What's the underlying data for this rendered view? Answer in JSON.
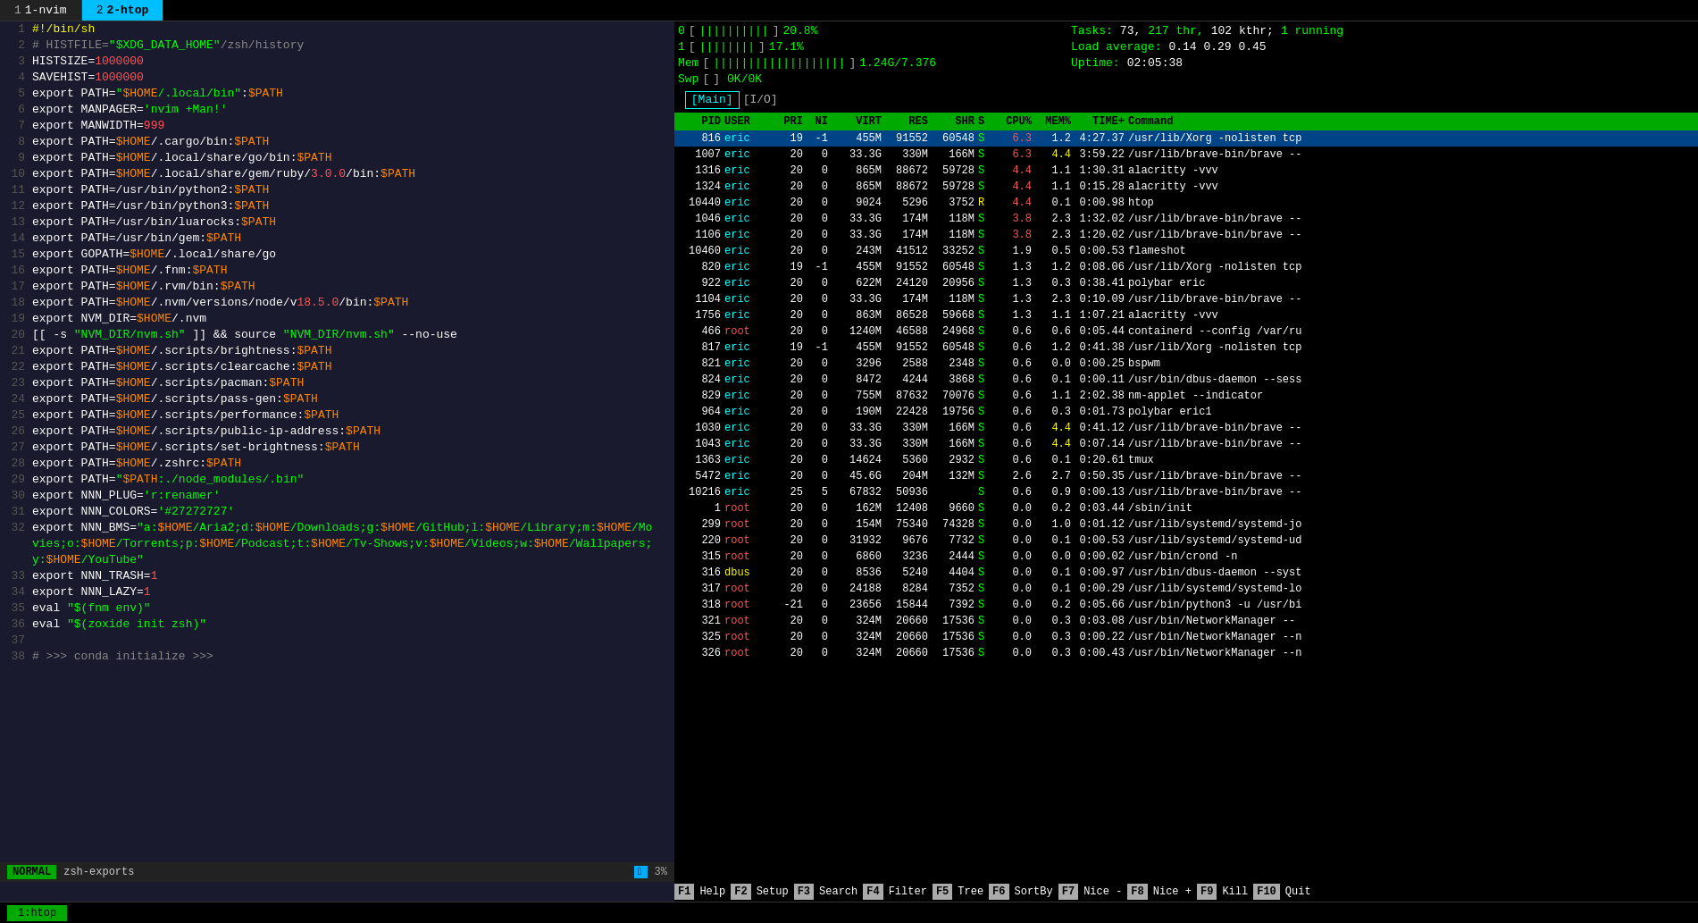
{
  "tabs": [
    {
      "id": "nvim",
      "num": "1",
      "name": "1-nvim",
      "active": false
    },
    {
      "id": "htop",
      "num": "2",
      "name": "2-htop",
      "active": true
    }
  ],
  "nvim": {
    "lines": [
      {
        "num": "1",
        "content": "#!/bin/sh"
      },
      {
        "num": "2",
        "content": "# HISTFILE=\"$XDG_DATA_HOME\"/zsh/history"
      },
      {
        "num": "3",
        "content": "HISTSIZE=1000000"
      },
      {
        "num": "4",
        "content": "SAVEHIST=1000000"
      },
      {
        "num": "5",
        "content": "export PATH=\"$HOME/.local/bin\":$PATH"
      },
      {
        "num": "6",
        "content": "export MANPAGER='nvim +Man!'"
      },
      {
        "num": "7",
        "content": "export MANWIDTH=999"
      },
      {
        "num": "8",
        "content": "export PATH=$HOME/.cargo/bin:$PATH"
      },
      {
        "num": "9",
        "content": "export PATH=$HOME/.local/share/go/bin:$PATH"
      },
      {
        "num": "10",
        "content": "export PATH=$HOME/.local/share/gem/ruby/3.0.0/bin:$PATH"
      },
      {
        "num": "11",
        "content": "export PATH=/usr/bin/python2:$PATH"
      },
      {
        "num": "12",
        "content": "export PATH=/usr/bin/python3:$PATH"
      },
      {
        "num": "13",
        "content": "export PATH=/usr/bin/luarocks:$PATH"
      },
      {
        "num": "14",
        "content": "export PATH=/usr/bin/gem:$PATH"
      },
      {
        "num": "15",
        "content": "export GOPATH=$HOME/.local/share/go"
      },
      {
        "num": "16",
        "content": "export PATH=$HOME/.fnm:$PATH"
      },
      {
        "num": "17",
        "content": "export PATH=$HOME/.rvm/bin:$PATH"
      },
      {
        "num": "18",
        "content": "export PATH=$HOME/.nvm/versions/node/v18.5.0/bin:$PATH"
      },
      {
        "num": "19",
        "content": "export NVM_DIR=$HOME/.nvm"
      },
      {
        "num": "20",
        "content": "[[ -s \"NVM_DIR/nvm.sh\" ]] && source \"NVM_DIR/nvm.sh\" --no-use"
      },
      {
        "num": "21",
        "content": "export PATH=$HOME/.scripts/brightness:$PATH"
      },
      {
        "num": "22",
        "content": "export PATH=$HOME/.scripts/clearcache:$PATH"
      },
      {
        "num": "23",
        "content": "export PATH=$HOME/.scripts/pacman:$PATH"
      },
      {
        "num": "24",
        "content": "export PATH=$HOME/.scripts/pass-gen:$PATH"
      },
      {
        "num": "25",
        "content": "export PATH=$HOME/.scripts/performance:$PATH"
      },
      {
        "num": "26",
        "content": "export PATH=$HOME/.scripts/public-ip-address:$PATH"
      },
      {
        "num": "27",
        "content": "export PATH=$HOME/.scripts/set-brightness:$PATH"
      },
      {
        "num": "28",
        "content": "export PATH=$HOME/.zshrc:$PATH"
      },
      {
        "num": "29",
        "content": "export PATH=\"$PATH:./node_modules/.bin\""
      },
      {
        "num": "30",
        "content": "export NNN_PLUG='r:renamer'"
      },
      {
        "num": "31",
        "content": "export NNN_COLORS='#27272727'"
      },
      {
        "num": "32",
        "content": "export NNN_BMS=\"a:$HOME/Aria2;d:$HOME/Downloads;g:$HOME/GitHub;l:$HOME/Library;m:$HOME/Mo"
      },
      {
        "num": "",
        "content": "vies;o:$HOME/Torrents;p:$HOME/Podcast;t:$HOME/Tv-Shows;v:$HOME/Videos;w:$HOME/Wallpapers;"
      },
      {
        "num": "",
        "content": "y:$HOME/YouTube\""
      },
      {
        "num": "33",
        "content": "export NNN_TRASH=1"
      },
      {
        "num": "34",
        "content": "export NNN_LAZY=1"
      },
      {
        "num": "35",
        "content": "eval \"$(fnm env)\""
      },
      {
        "num": "36",
        "content": "eval \"$(zoxide init zsh)\""
      },
      {
        "num": "37",
        "content": ""
      },
      {
        "num": "38",
        "content": "# >>> conda initialize >>>"
      }
    ],
    "mode": "NORMAL",
    "filename": "zsh-exports",
    "file_icon": "",
    "pct": "3%"
  },
  "htop": {
    "cpu0_label": "0",
    "cpu0_bar": "||||||||||",
    "cpu0_pct": "20.8%",
    "cpu1_label": "1",
    "cpu1_bar": "||||||||",
    "cpu1_pct": "17.1%",
    "mem_label": "Mem",
    "mem_bar": "|||||||||||||||||||",
    "mem_val": "1.24G/7.376",
    "swp_label": "Swp",
    "swp_bar": "",
    "swp_val": "0K/0K",
    "tasks_label": "Tasks:",
    "tasks_val": "73, 217 thr, 102 kthr; 1 running",
    "load_label": "Load average:",
    "load_val": "0.14 0.29 0.45",
    "uptime_label": "Uptime:",
    "uptime_val": "02:05:38",
    "menu": "[Main] [I/O]",
    "columns": [
      "PID",
      "USER",
      "PRI",
      "NI",
      "VIRT",
      "RES",
      "SHR",
      "S",
      "CPU%",
      "MEM%",
      "TIME+",
      "Command"
    ],
    "processes": [
      {
        "pid": "816",
        "user": "eric",
        "pri": "19",
        "ni": "-1",
        "virt": "455M",
        "res": "91552",
        "shr": "60548",
        "s": "S",
        "cpu": "6.3",
        "mem": "1.2",
        "time": "4:27.37",
        "cmd": "/usr/lib/Xorg -nolisten tcp",
        "highlight": true
      },
      {
        "pid": "1007",
        "user": "eric",
        "pri": "20",
        "ni": "0",
        "virt": "33.3G",
        "res": "330M",
        "shr": "166M",
        "s": "S",
        "cpu": "6.3",
        "mem": "4.4",
        "time": "3:59.22",
        "cmd": "/usr/lib/brave-bin/brave --"
      },
      {
        "pid": "1316",
        "user": "eric",
        "pri": "20",
        "ni": "0",
        "virt": "865M",
        "res": "88672",
        "shr": "59728",
        "s": "S",
        "cpu": "4.4",
        "mem": "1.1",
        "time": "1:30.31",
        "cmd": "alacritty -vvv"
      },
      {
        "pid": "1324",
        "user": "eric",
        "pri": "20",
        "ni": "0",
        "virt": "865M",
        "res": "88672",
        "shr": "59728",
        "s": "S",
        "cpu": "4.4",
        "mem": "1.1",
        "time": "0:15.28",
        "cmd": "alacritty -vvv"
      },
      {
        "pid": "10440",
        "user": "eric",
        "pri": "20",
        "ni": "0",
        "virt": "9024",
        "res": "5296",
        "shr": "3752",
        "s": "R",
        "cpu": "4.4",
        "mem": "0.1",
        "time": "0:00.98",
        "cmd": "htop"
      },
      {
        "pid": "1046",
        "user": "eric",
        "pri": "20",
        "ni": "0",
        "virt": "33.3G",
        "res": "174M",
        "shr": "118M",
        "s": "S",
        "cpu": "3.8",
        "mem": "2.3",
        "time": "1:32.02",
        "cmd": "/usr/lib/brave-bin/brave --"
      },
      {
        "pid": "1106",
        "user": "eric",
        "pri": "20",
        "ni": "0",
        "virt": "33.3G",
        "res": "174M",
        "shr": "118M",
        "s": "S",
        "cpu": "3.8",
        "mem": "2.3",
        "time": "1:20.02",
        "cmd": "/usr/lib/brave-bin/brave --"
      },
      {
        "pid": "10460",
        "user": "eric",
        "pri": "20",
        "ni": "0",
        "virt": "243M",
        "res": "41512",
        "shr": "33252",
        "s": "S",
        "cpu": "1.9",
        "mem": "0.5",
        "time": "0:00.53",
        "cmd": "flameshot"
      },
      {
        "pid": "820",
        "user": "eric",
        "pri": "19",
        "ni": "-1",
        "virt": "455M",
        "res": "91552",
        "shr": "60548",
        "s": "S",
        "cpu": "1.3",
        "mem": "1.2",
        "time": "0:08.06",
        "cmd": "/usr/lib/Xorg -nolisten tcp"
      },
      {
        "pid": "922",
        "user": "eric",
        "pri": "20",
        "ni": "0",
        "virt": "622M",
        "res": "24120",
        "shr": "20956",
        "s": "S",
        "cpu": "1.3",
        "mem": "0.3",
        "time": "0:38.41",
        "cmd": "polybar eric"
      },
      {
        "pid": "1104",
        "user": "eric",
        "pri": "20",
        "ni": "0",
        "virt": "33.3G",
        "res": "174M",
        "shr": "118M",
        "s": "S",
        "cpu": "1.3",
        "mem": "2.3",
        "time": "0:10.09",
        "cmd": "/usr/lib/brave-bin/brave --"
      },
      {
        "pid": "1756",
        "user": "eric",
        "pri": "20",
        "ni": "0",
        "virt": "863M",
        "res": "86528",
        "shr": "59668",
        "s": "S",
        "cpu": "1.3",
        "mem": "1.1",
        "time": "1:07.21",
        "cmd": "alacritty -vvv"
      },
      {
        "pid": "466",
        "user": "root",
        "pri": "20",
        "ni": "0",
        "virt": "1240M",
        "res": "46588",
        "shr": "24968",
        "s": "S",
        "cpu": "0.6",
        "mem": "0.6",
        "time": "0:05.44",
        "cmd": "containerd --config /var/ru"
      },
      {
        "pid": "817",
        "user": "eric",
        "pri": "19",
        "ni": "-1",
        "virt": "455M",
        "res": "91552",
        "shr": "60548",
        "s": "S",
        "cpu": "0.6",
        "mem": "1.2",
        "time": "0:41.38",
        "cmd": "/usr/lib/Xorg -nolisten tcp"
      },
      {
        "pid": "821",
        "user": "eric",
        "pri": "20",
        "ni": "0",
        "virt": "3296",
        "res": "2588",
        "shr": "2348",
        "s": "S",
        "cpu": "0.6",
        "mem": "0.0",
        "time": "0:00.25",
        "cmd": "bspwm"
      },
      {
        "pid": "824",
        "user": "eric",
        "pri": "20",
        "ni": "0",
        "virt": "8472",
        "res": "4244",
        "shr": "3868",
        "s": "S",
        "cpu": "0.6",
        "mem": "0.1",
        "time": "0:00.11",
        "cmd": "/usr/bin/dbus-daemon --sess"
      },
      {
        "pid": "829",
        "user": "eric",
        "pri": "20",
        "ni": "0",
        "virt": "755M",
        "res": "87632",
        "shr": "70076",
        "s": "S",
        "cpu": "0.6",
        "mem": "1.1",
        "time": "2:02.38",
        "cmd": "nm-applet --indicator"
      },
      {
        "pid": "964",
        "user": "eric",
        "pri": "20",
        "ni": "0",
        "virt": "190M",
        "res": "22428",
        "shr": "19756",
        "s": "S",
        "cpu": "0.6",
        "mem": "0.3",
        "time": "0:01.73",
        "cmd": "polybar eric1"
      },
      {
        "pid": "1030",
        "user": "eric",
        "pri": "20",
        "ni": "0",
        "virt": "33.3G",
        "res": "330M",
        "shr": "166M",
        "s": "S",
        "cpu": "0.6",
        "mem": "4.4",
        "time": "0:41.12",
        "cmd": "/usr/lib/brave-bin/brave --"
      },
      {
        "pid": "1043",
        "user": "eric",
        "pri": "20",
        "ni": "0",
        "virt": "33.3G",
        "res": "330M",
        "shr": "166M",
        "s": "S",
        "cpu": "0.6",
        "mem": "4.4",
        "time": "0:07.14",
        "cmd": "/usr/lib/brave-bin/brave --"
      },
      {
        "pid": "1363",
        "user": "eric",
        "pri": "20",
        "ni": "0",
        "virt": "14624",
        "res": "5360",
        "shr": "2932",
        "s": "S",
        "cpu": "0.6",
        "mem": "0.1",
        "time": "0:20.61",
        "cmd": "tmux"
      },
      {
        "pid": "5472",
        "user": "eric",
        "pri": "20",
        "ni": "0",
        "virt": "45.6G",
        "res": "204M",
        "shr": "132M",
        "s": "S",
        "cpu": "2.6",
        "mem": "2.7",
        "time": "0:50.35",
        "cmd": "/usr/lib/brave-bin/brave --"
      },
      {
        "pid": "10216",
        "user": "eric",
        "pri": "25",
        "ni": "5",
        "virt": "67832",
        "res": "50936",
        "shr": "",
        "s": "S",
        "cpu": "0.6",
        "mem": "0.9",
        "time": "0:00.13",
        "cmd": "/usr/lib/brave-bin/brave --"
      },
      {
        "pid": "1",
        "user": "root",
        "pri": "20",
        "ni": "0",
        "virt": "162M",
        "res": "12408",
        "shr": "9660",
        "s": "S",
        "cpu": "0.0",
        "mem": "0.2",
        "time": "0:03.44",
        "cmd": "/sbin/init"
      },
      {
        "pid": "299",
        "user": "root",
        "pri": "20",
        "ni": "0",
        "virt": "154M",
        "res": "75340",
        "shr": "74328",
        "s": "S",
        "cpu": "0.0",
        "mem": "1.0",
        "time": "0:01.12",
        "cmd": "/usr/lib/systemd/systemd-jo"
      },
      {
        "pid": "220",
        "user": "root",
        "pri": "20",
        "ni": "0",
        "virt": "31932",
        "res": "9676",
        "shr": "7732",
        "s": "S",
        "cpu": "0.0",
        "mem": "0.1",
        "time": "0:00.53",
        "cmd": "/usr/lib/systemd/systemd-ud"
      },
      {
        "pid": "315",
        "user": "root",
        "pri": "20",
        "ni": "0",
        "virt": "6860",
        "res": "3236",
        "shr": "2444",
        "s": "S",
        "cpu": "0.0",
        "mem": "0.0",
        "time": "0:00.02",
        "cmd": "/usr/bin/crond -n"
      },
      {
        "pid": "316",
        "user": "dbus",
        "pri": "20",
        "ni": "0",
        "virt": "8536",
        "res": "5240",
        "shr": "4404",
        "s": "S",
        "cpu": "0.0",
        "mem": "0.1",
        "time": "0:00.97",
        "cmd": "/usr/bin/dbus-daemon --syst"
      },
      {
        "pid": "317",
        "user": "root",
        "pri": "20",
        "ni": "0",
        "virt": "24188",
        "res": "8284",
        "shr": "7352",
        "s": "S",
        "cpu": "0.0",
        "mem": "0.1",
        "time": "0:00.29",
        "cmd": "/usr/lib/systemd/systemd-lo"
      },
      {
        "pid": "318",
        "user": "root",
        "pri": "-21",
        "ni": "0",
        "virt": "23656",
        "res": "15844",
        "shr": "7392",
        "s": "S",
        "cpu": "0.0",
        "mem": "0.2",
        "time": "0:05.66",
        "cmd": "/usr/bin/python3 -u /usr/bi"
      },
      {
        "pid": "321",
        "user": "root",
        "pri": "20",
        "ni": "0",
        "virt": "324M",
        "res": "20660",
        "shr": "17536",
        "s": "S",
        "cpu": "0.0",
        "mem": "0.3",
        "time": "0:03.08",
        "cmd": "/usr/bin/NetworkManager --"
      },
      {
        "pid": "325",
        "user": "root",
        "pri": "20",
        "ni": "0",
        "virt": "324M",
        "res": "20660",
        "shr": "17536",
        "s": "S",
        "cpu": "0.0",
        "mem": "0.3",
        "time": "0:00.22",
        "cmd": "/usr/bin/NetworkManager --n"
      },
      {
        "pid": "326",
        "user": "root",
        "pri": "20",
        "ni": "0",
        "virt": "324M",
        "res": "20660",
        "shr": "17536",
        "s": "S",
        "cpu": "0.0",
        "mem": "0.3",
        "time": "0:00.43",
        "cmd": "/usr/bin/NetworkManager --n"
      }
    ],
    "fn_buttons": [
      {
        "num": "F1",
        "label": "Help"
      },
      {
        "num": "F2",
        "label": "Setup"
      },
      {
        "num": "F3",
        "label": "Search"
      },
      {
        "num": "F4",
        "label": "Filter"
      },
      {
        "num": "F5",
        "label": "Tree"
      },
      {
        "num": "F6",
        "label": "SortBy"
      },
      {
        "num": "F7",
        "label": "Nice -"
      },
      {
        "num": "F8",
        "label": "Nice +"
      },
      {
        "num": "F9",
        "label": "Kill"
      },
      {
        "num": "F10",
        "label": "Quit"
      }
    ]
  },
  "terminal_bottom": {
    "tab_label": "1:htop"
  }
}
